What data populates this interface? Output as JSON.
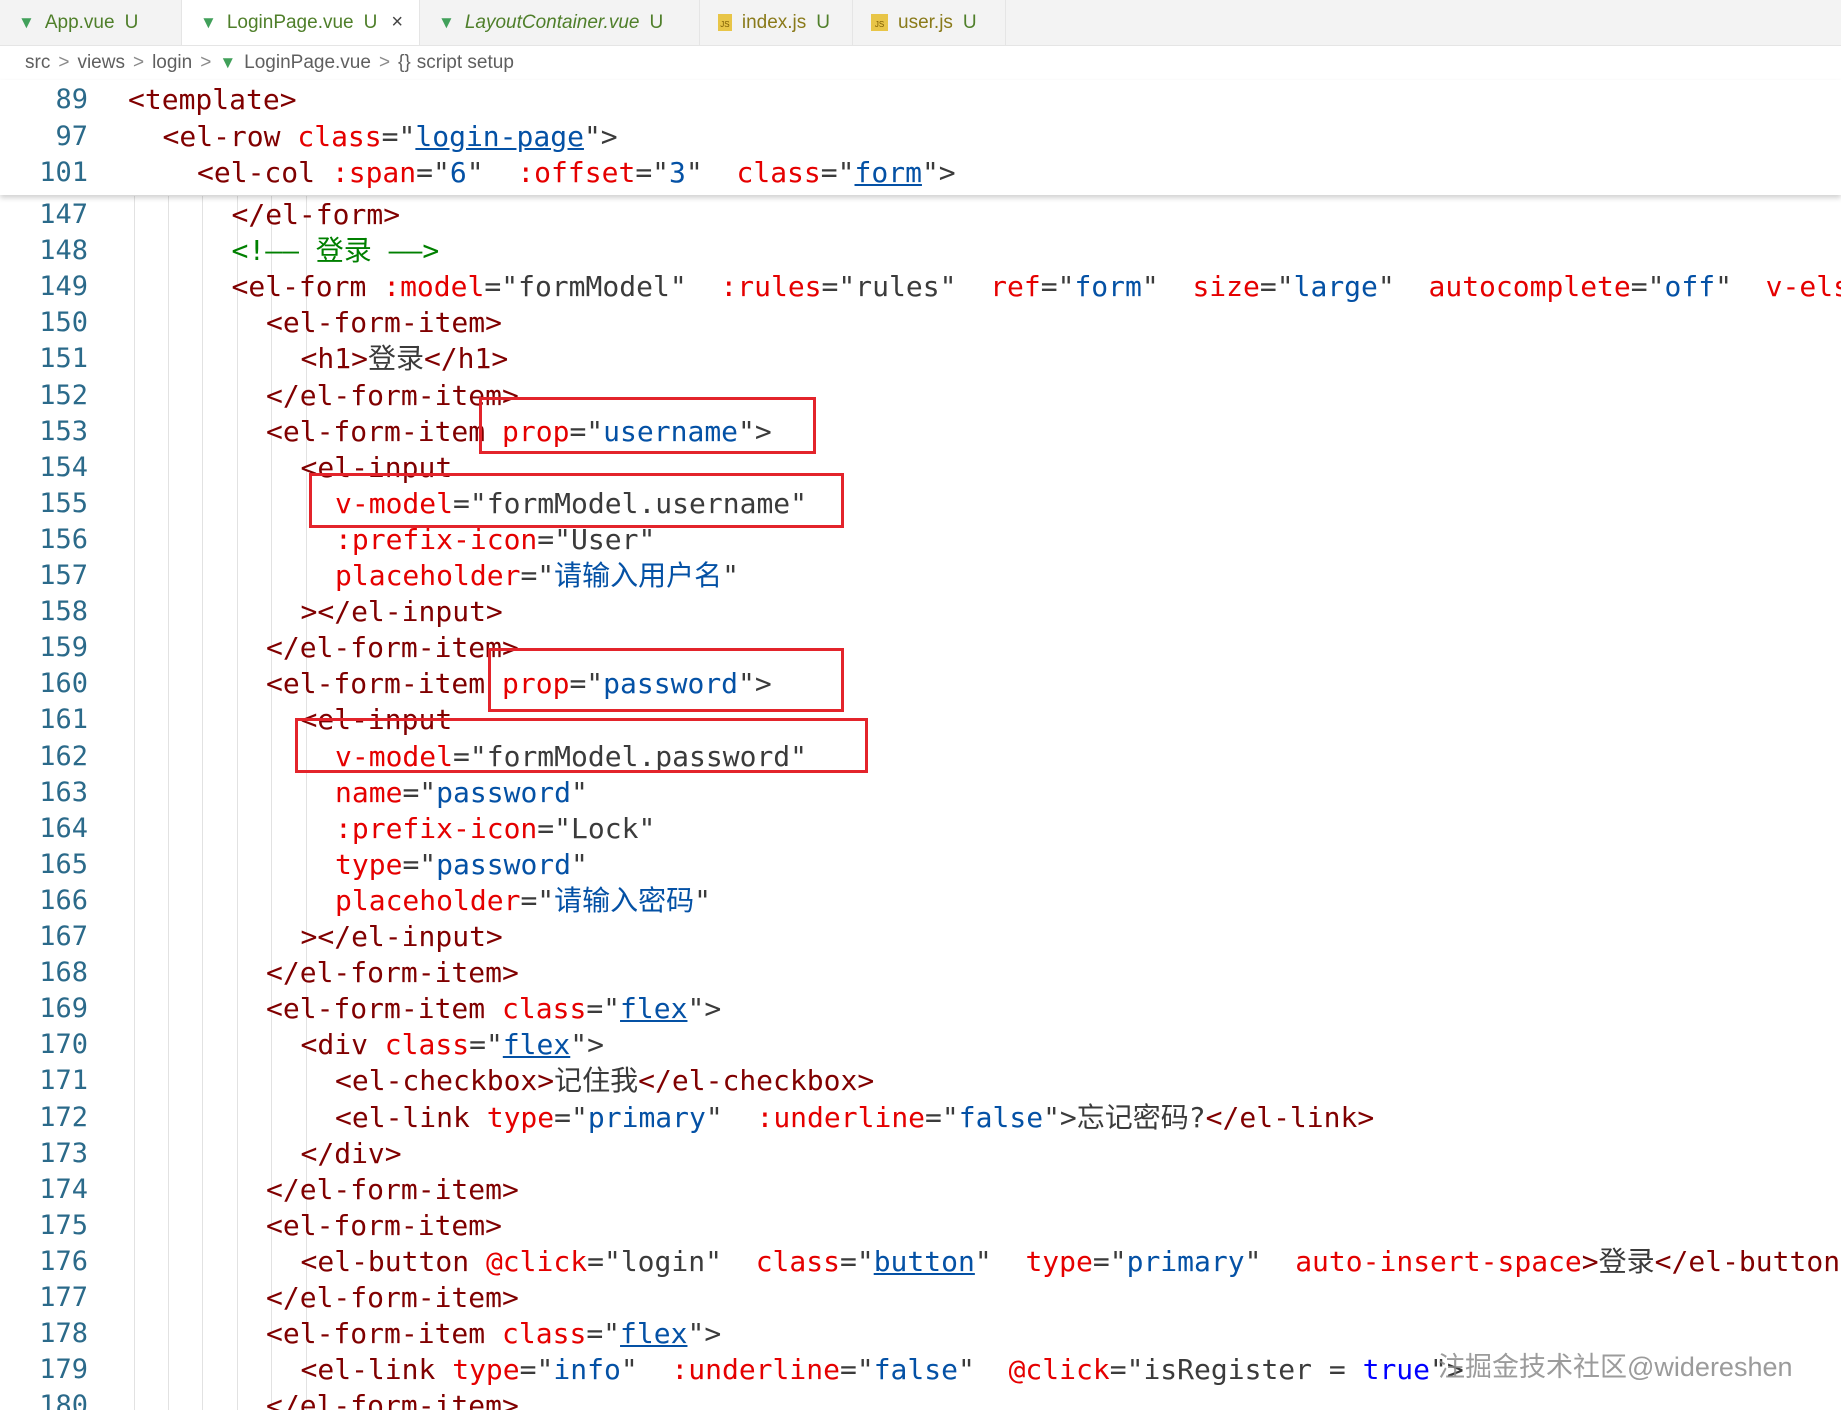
{
  "tabs": [
    {
      "name": "App.vue",
      "status": "U",
      "type": "vue"
    },
    {
      "name": "LoginPage.vue",
      "status": "U",
      "type": "vue",
      "active": true,
      "close": "×"
    },
    {
      "name": "LayoutContainer.vue",
      "status": "U",
      "type": "vue",
      "italic": true
    },
    {
      "name": "index.js",
      "status": "U",
      "type": "js"
    },
    {
      "name": "user.js",
      "status": "U",
      "type": "js"
    }
  ],
  "breadcrumb": {
    "parts": [
      "src",
      "views",
      "login"
    ],
    "file": "LoginPage.vue",
    "symbol_icon": "{}",
    "symbol": "script setup",
    "separator": ">"
  },
  "sticky_lines": [
    {
      "n": "89",
      "indent": 0,
      "tokens": [
        [
          "tg",
          "<template>"
        ]
      ]
    },
    {
      "n": "97",
      "indent": 1,
      "tokens": [
        [
          "tg",
          "<el-row "
        ],
        [
          "at",
          "class"
        ],
        [
          "pu",
          "=\""
        ],
        [
          "cl",
          "login-page"
        ],
        [
          "pu",
          "\">"
        ]
      ]
    },
    {
      "n": "101",
      "indent": 2,
      "tokens": [
        [
          "tg",
          "<el-col "
        ],
        [
          "at",
          ":span"
        ],
        [
          "pu",
          "=\""
        ],
        [
          "sv",
          "6"
        ],
        [
          "pu",
          "\"  "
        ],
        [
          "at",
          ":offset"
        ],
        [
          "pu",
          "=\""
        ],
        [
          "sv",
          "3"
        ],
        [
          "pu",
          "\"  "
        ],
        [
          "at",
          "class"
        ],
        [
          "pu",
          "=\""
        ],
        [
          "cl",
          "form"
        ],
        [
          "pu",
          "\">"
        ]
      ]
    }
  ],
  "code_lines": [
    {
      "n": "147",
      "indent": 3,
      "tokens": [
        [
          "tg",
          "</el-form>"
        ]
      ]
    },
    {
      "n": "148",
      "indent": 3,
      "tokens": [
        [
          "cm",
          "<!—— 登录 ——>"
        ]
      ]
    },
    {
      "n": "149",
      "indent": 3,
      "tokens": [
        [
          "tg",
          "<el-form "
        ],
        [
          "at",
          ":model"
        ],
        [
          "pu",
          "=\""
        ],
        [
          "tx",
          "formModel"
        ],
        [
          "pu",
          "\"  "
        ],
        [
          "at",
          ":rules"
        ],
        [
          "pu",
          "=\""
        ],
        [
          "tx",
          "rules"
        ],
        [
          "pu",
          "\"  "
        ],
        [
          "at",
          "ref"
        ],
        [
          "pu",
          "=\""
        ],
        [
          "sv",
          "form"
        ],
        [
          "pu",
          "\"  "
        ],
        [
          "at",
          "size"
        ],
        [
          "pu",
          "=\""
        ],
        [
          "sv",
          "large"
        ],
        [
          "pu",
          "\"  "
        ],
        [
          "at",
          "autocomplete"
        ],
        [
          "pu",
          "=\""
        ],
        [
          "sv",
          "off"
        ],
        [
          "pu",
          "\"  "
        ],
        [
          "at",
          "v-else"
        ],
        [
          "tg",
          ">"
        ]
      ]
    },
    {
      "n": "150",
      "indent": 4,
      "tokens": [
        [
          "tg",
          "<el-form-item>"
        ]
      ]
    },
    {
      "n": "151",
      "indent": 5,
      "tokens": [
        [
          "tg",
          "<h1>"
        ],
        [
          "tx",
          "登录"
        ],
        [
          "tg",
          "</h1>"
        ]
      ]
    },
    {
      "n": "152",
      "indent": 4,
      "tokens": [
        [
          "tg",
          "</el-form-item>"
        ]
      ]
    },
    {
      "n": "153",
      "indent": 4,
      "tokens": [
        [
          "tg",
          "<el-form-item "
        ],
        [
          "at",
          "prop"
        ],
        [
          "pu",
          "=\""
        ],
        [
          "sv",
          "username"
        ],
        [
          "pu",
          "\">"
        ]
      ]
    },
    {
      "n": "154",
      "indent": 5,
      "tokens": [
        [
          "tg",
          "<el-input"
        ]
      ]
    },
    {
      "n": "155",
      "indent": 6,
      "tokens": [
        [
          "at",
          "v-model"
        ],
        [
          "pu",
          "=\""
        ],
        [
          "tx",
          "formModel.username"
        ],
        [
          "pu",
          "\""
        ]
      ]
    },
    {
      "n": "156",
      "indent": 6,
      "tokens": [
        [
          "at",
          ":prefix-icon"
        ],
        [
          "pu",
          "=\""
        ],
        [
          "tx",
          "User"
        ],
        [
          "pu",
          "\""
        ]
      ]
    },
    {
      "n": "157",
      "indent": 6,
      "tokens": [
        [
          "at",
          "placeholder"
        ],
        [
          "pu",
          "=\""
        ],
        [
          "sv",
          "请输入用户名"
        ],
        [
          "pu",
          "\""
        ]
      ]
    },
    {
      "n": "158",
      "indent": 5,
      "tokens": [
        [
          "tg",
          "></el-input>"
        ]
      ]
    },
    {
      "n": "159",
      "indent": 4,
      "tokens": [
        [
          "tg",
          "</el-form-item>"
        ]
      ]
    },
    {
      "n": "160",
      "indent": 4,
      "tokens": [
        [
          "tg",
          "<el-form-item "
        ],
        [
          "at",
          "prop"
        ],
        [
          "pu",
          "=\""
        ],
        [
          "sv",
          "password"
        ],
        [
          "pu",
          "\">"
        ]
      ]
    },
    {
      "n": "161",
      "indent": 5,
      "tokens": [
        [
          "tg",
          "<el-input"
        ]
      ]
    },
    {
      "n": "162",
      "indent": 6,
      "tokens": [
        [
          "at",
          "v-model"
        ],
        [
          "pu",
          "=\""
        ],
        [
          "tx",
          "formModel.password"
        ],
        [
          "pu",
          "\""
        ]
      ]
    },
    {
      "n": "163",
      "indent": 6,
      "tokens": [
        [
          "at",
          "name"
        ],
        [
          "pu",
          "=\""
        ],
        [
          "sv",
          "password"
        ],
        [
          "pu",
          "\""
        ]
      ]
    },
    {
      "n": "164",
      "indent": 6,
      "tokens": [
        [
          "at",
          ":prefix-icon"
        ],
        [
          "pu",
          "=\""
        ],
        [
          "tx",
          "Lock"
        ],
        [
          "pu",
          "\""
        ]
      ]
    },
    {
      "n": "165",
      "indent": 6,
      "tokens": [
        [
          "at",
          "type"
        ],
        [
          "pu",
          "=\""
        ],
        [
          "sv",
          "password"
        ],
        [
          "pu",
          "\""
        ]
      ]
    },
    {
      "n": "166",
      "indent": 6,
      "tokens": [
        [
          "at",
          "placeholder"
        ],
        [
          "pu",
          "=\""
        ],
        [
          "sv",
          "请输入密码"
        ],
        [
          "pu",
          "\""
        ]
      ]
    },
    {
      "n": "167",
      "indent": 5,
      "tokens": [
        [
          "tg",
          "></el-input>"
        ]
      ]
    },
    {
      "n": "168",
      "indent": 4,
      "tokens": [
        [
          "tg",
          "</el-form-item>"
        ]
      ]
    },
    {
      "n": "169",
      "indent": 4,
      "tokens": [
        [
          "tg",
          "<el-form-item "
        ],
        [
          "at",
          "class"
        ],
        [
          "pu",
          "=\""
        ],
        [
          "cl",
          "flex"
        ],
        [
          "pu",
          "\">"
        ]
      ]
    },
    {
      "n": "170",
      "indent": 5,
      "tokens": [
        [
          "tg",
          "<div "
        ],
        [
          "at",
          "class"
        ],
        [
          "pu",
          "=\""
        ],
        [
          "cl",
          "flex"
        ],
        [
          "pu",
          "\">"
        ]
      ]
    },
    {
      "n": "171",
      "indent": 6,
      "tokens": [
        [
          "tg",
          "<el-checkbox>"
        ],
        [
          "tx",
          "记住我"
        ],
        [
          "tg",
          "</el-checkbox>"
        ]
      ]
    },
    {
      "n": "172",
      "indent": 6,
      "tokens": [
        [
          "tg",
          "<el-link "
        ],
        [
          "at",
          "type"
        ],
        [
          "pu",
          "=\""
        ],
        [
          "sv",
          "primary"
        ],
        [
          "pu",
          "\"  "
        ],
        [
          "at",
          ":underline"
        ],
        [
          "pu",
          "=\""
        ],
        [
          "sv",
          "false"
        ],
        [
          "pu",
          "\">"
        ],
        [
          "tx",
          "忘记密码?"
        ],
        [
          "tg",
          "</el-link>"
        ]
      ]
    },
    {
      "n": "173",
      "indent": 5,
      "tokens": [
        [
          "tg",
          "</div>"
        ]
      ]
    },
    {
      "n": "174",
      "indent": 4,
      "tokens": [
        [
          "tg",
          "</el-form-item>"
        ]
      ]
    },
    {
      "n": "175",
      "indent": 4,
      "tokens": [
        [
          "tg",
          "<el-form-item>"
        ]
      ]
    },
    {
      "n": "176",
      "indent": 5,
      "tokens": [
        [
          "tg",
          "<el-button "
        ],
        [
          "at",
          "@click"
        ],
        [
          "pu",
          "=\""
        ],
        [
          "tx",
          "login"
        ],
        [
          "pu",
          "\"  "
        ],
        [
          "at",
          "class"
        ],
        [
          "pu",
          "=\""
        ],
        [
          "cl",
          "button"
        ],
        [
          "pu",
          "\"  "
        ],
        [
          "at",
          "type"
        ],
        [
          "pu",
          "=\""
        ],
        [
          "sv",
          "primary"
        ],
        [
          "pu",
          "\"  "
        ],
        [
          "at",
          "auto-insert-space"
        ],
        [
          "tg",
          ">"
        ],
        [
          "tx",
          "登录"
        ],
        [
          "tg",
          "</el-button>"
        ]
      ]
    },
    {
      "n": "177",
      "indent": 4,
      "tokens": [
        [
          "tg",
          "</el-form-item>"
        ]
      ]
    },
    {
      "n": "178",
      "indent": 4,
      "tokens": [
        [
          "tg",
          "<el-form-item "
        ],
        [
          "at",
          "class"
        ],
        [
          "pu",
          "=\""
        ],
        [
          "cl",
          "flex"
        ],
        [
          "pu",
          "\">"
        ]
      ]
    },
    {
      "n": "179",
      "indent": 5,
      "tokens": [
        [
          "tg",
          "<el-link "
        ],
        [
          "at",
          "type"
        ],
        [
          "pu",
          "=\""
        ],
        [
          "sv",
          "info"
        ],
        [
          "pu",
          "\"  "
        ],
        [
          "at",
          ":underline"
        ],
        [
          "pu",
          "=\""
        ],
        [
          "sv",
          "false"
        ],
        [
          "pu",
          "\"  "
        ],
        [
          "at",
          "@click"
        ],
        [
          "pu",
          "=\""
        ],
        [
          "tx",
          "isRegister "
        ],
        [
          "pu",
          "= "
        ],
        [
          "kw",
          "true"
        ],
        [
          "pu",
          "\">"
        ]
      ]
    },
    {
      "n": "180",
      "indent": 4,
      "tokens": [
        [
          "tg",
          "</el-form-item>"
        ]
      ]
    }
  ],
  "highlights": [
    {
      "label": "prop=\"username\""
    },
    {
      "label": "v-model=\"formModel.username\""
    },
    {
      "label": "prop=\"password\""
    },
    {
      "label": "v-model=\"formModel.password\""
    }
  ],
  "watermark": "注掘金技术社区@widereshen",
  "colors": {
    "tag": "#800000",
    "attribute": "#e50000",
    "string": "#0451a5",
    "comment": "#008000",
    "keyword": "#0000ff",
    "line_number": "#2b6a8a",
    "highlight_box": "#e3242b"
  },
  "icons": {
    "vue_file": "vue-icon",
    "js_file": "js-icon",
    "close": "close-icon"
  }
}
